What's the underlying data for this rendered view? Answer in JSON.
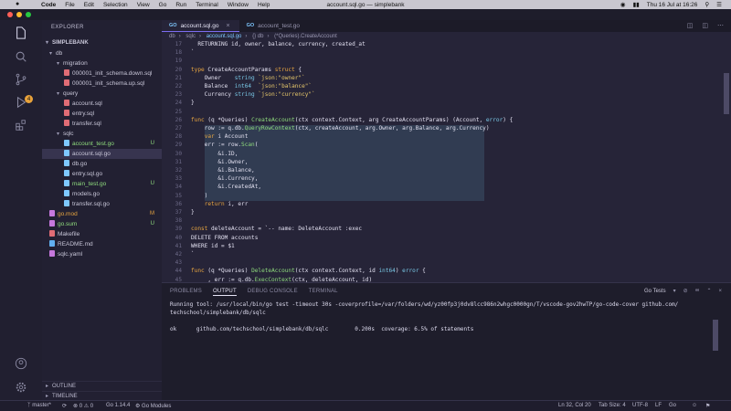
{
  "menubar": {
    "apple": "",
    "items": [
      "Code",
      "File",
      "Edit",
      "Selection",
      "View",
      "Go",
      "Run",
      "Terminal",
      "Window",
      "Help"
    ],
    "window_title": "account.sql.go — simplebank",
    "clock": "Thu 16 Jul at 16:26"
  },
  "sidebar": {
    "header": "EXPLORER",
    "project": "SIMPLEBANK",
    "tree": [
      {
        "label": "db",
        "type": "folder",
        "depth": 0,
        "status": "",
        "color": ""
      },
      {
        "label": "migration",
        "type": "folder",
        "depth": 1,
        "status": "",
        "color": ""
      },
      {
        "label": "000001_init_schema.down.sql",
        "type": "file",
        "depth": 2,
        "status": "",
        "color": "#e06c75"
      },
      {
        "label": "000001_init_schema.up.sql",
        "type": "file",
        "depth": 2,
        "status": "",
        "color": "#e06c75"
      },
      {
        "label": "query",
        "type": "folder",
        "depth": 1,
        "status": "",
        "color": ""
      },
      {
        "label": "account.sql",
        "type": "file",
        "depth": 2,
        "status": "",
        "color": "#e06c75"
      },
      {
        "label": "entry.sql",
        "type": "file",
        "depth": 2,
        "status": "",
        "color": "#e06c75"
      },
      {
        "label": "transfer.sql",
        "type": "file",
        "depth": 2,
        "status": "",
        "color": "#e06c75"
      },
      {
        "label": "sqlc",
        "type": "folder",
        "depth": 1,
        "status": "",
        "color": ""
      },
      {
        "label": "account_test.go",
        "type": "file",
        "depth": 2,
        "status": "U",
        "color": "#7ec8ff"
      },
      {
        "label": "account.sql.go",
        "type": "file",
        "depth": 2,
        "status": "",
        "color": "#7ec8ff"
      },
      {
        "label": "db.go",
        "type": "file",
        "depth": 2,
        "status": "",
        "color": "#7ec8ff"
      },
      {
        "label": "entry.sql.go",
        "type": "file",
        "depth": 2,
        "status": "",
        "color": "#7ec8ff"
      },
      {
        "label": "main_test.go",
        "type": "file",
        "depth": 2,
        "status": "U",
        "color": "#7ec8ff"
      },
      {
        "label": "models.go",
        "type": "file",
        "depth": 2,
        "status": "",
        "color": "#7ec8ff"
      },
      {
        "label": "transfer.sql.go",
        "type": "file",
        "depth": 2,
        "status": "",
        "color": "#7ec8ff"
      },
      {
        "label": "go.mod",
        "type": "file",
        "depth": 0,
        "status": "M",
        "color": "#c678dd"
      },
      {
        "label": "go.sum",
        "type": "file",
        "depth": 0,
        "status": "U",
        "color": "#c678dd"
      },
      {
        "label": "Makefile",
        "type": "file",
        "depth": 0,
        "status": "",
        "color": "#e06c75"
      },
      {
        "label": "README.md",
        "type": "file",
        "depth": 0,
        "status": "",
        "color": "#61afef"
      },
      {
        "label": "sqlc.yaml",
        "type": "file",
        "depth": 0,
        "status": "",
        "color": "#c678dd"
      }
    ],
    "outline": "OUTLINE",
    "timeline": "TIMELINE"
  },
  "tabs": [
    {
      "label": "account.sql.go",
      "icon": "go",
      "active": true
    },
    {
      "label": "account_test.go",
      "icon": "go",
      "active": false
    }
  ],
  "breadcrumb": [
    "db",
    "sqlc",
    "account.sql.go",
    "{} db",
    "(*Queries).CreateAccount"
  ],
  "code": {
    "lines": [
      {
        "n": "17",
        "t": "  RETURNING id, owner, balance, currency, created_at"
      },
      {
        "n": "18",
        "t": "`"
      },
      {
        "n": "19",
        "t": ""
      },
      {
        "n": "20",
        "t": "type CreateAccountParams struct {"
      },
      {
        "n": "21",
        "t": "    Owner    string `json:\"owner\"`"
      },
      {
        "n": "22",
        "t": "    Balance  int64  `json:\"balance\"`"
      },
      {
        "n": "23",
        "t": "    Currency string `json:\"currency\"`"
      },
      {
        "n": "24",
        "t": "}"
      },
      {
        "n": "25",
        "t": ""
      },
      {
        "n": "26",
        "t": "func (q *Queries) CreateAccount(ctx context.Context, arg CreateAccountParams) (Account, error) {"
      },
      {
        "n": "27",
        "t": "    row := q.db.QueryRowContext(ctx, createAccount, arg.Owner, arg.Balance, arg.Currency)"
      },
      {
        "n": "28",
        "t": "    var i Account"
      },
      {
        "n": "29",
        "t": "    err := row.Scan("
      },
      {
        "n": "30",
        "t": "        &i.ID,"
      },
      {
        "n": "31",
        "t": "        &i.Owner,"
      },
      {
        "n": "32",
        "t": "        &i.Balance,"
      },
      {
        "n": "33",
        "t": "        &i.Currency,"
      },
      {
        "n": "34",
        "t": "        &i.CreatedAt,"
      },
      {
        "n": "35",
        "t": "    )"
      },
      {
        "n": "36",
        "t": "    return i, err"
      },
      {
        "n": "37",
        "t": "}"
      },
      {
        "n": "38",
        "t": ""
      },
      {
        "n": "39",
        "t": "const deleteAccount = `-- name: DeleteAccount :exec"
      },
      {
        "n": "40",
        "t": "DELETE FROM accounts"
      },
      {
        "n": "41",
        "t": "WHERE id = $1"
      },
      {
        "n": "42",
        "t": "`"
      },
      {
        "n": "43",
        "t": ""
      },
      {
        "n": "44",
        "t": "func (q *Queries) DeleteAccount(ctx context.Context, id int64) error {"
      },
      {
        "n": "45",
        "t": "    _, err := q.db.ExecContext(ctx, deleteAccount, id)"
      }
    ]
  },
  "panel": {
    "tabs": [
      "PROBLEMS",
      "OUTPUT",
      "DEBUG CONSOLE",
      "TERMINAL"
    ],
    "active_tab": "OUTPUT",
    "channel": "Go Tests",
    "output": [
      "Running tool: /usr/local/bin/go test -timeout 30s -coverprofile=/var/folders/wd/yz00fp3j0dv8lcc986n2whgc0000gn/T/vscode-gov2hwTP/go-code-cover github.com/",
      "techschool/simplebank/db/sqlc",
      "",
      "ok  \tgithub.com/techschool/simplebank/db/sqlc\t0.200s\tcoverage: 6.5% of statements"
    ]
  },
  "statusbar": {
    "branch": "master*",
    "sync": "⟳",
    "errors": "0",
    "warnings": "0",
    "go_version": "Go 1.14.4",
    "go_modules": "Go Modules",
    "position": "Ln 32, Col 20",
    "tab_size": "Tab Size: 4",
    "encoding": "UTF-8",
    "eol": "LF",
    "language": "Go"
  },
  "colors": {
    "accent": "#7b6cf0",
    "editor_bg": "#262438",
    "selection": "#3a5068"
  }
}
